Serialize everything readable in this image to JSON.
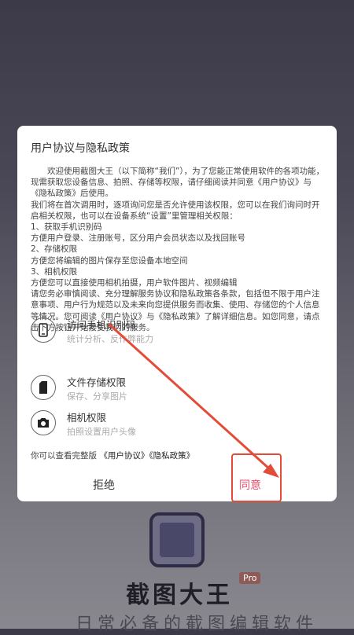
{
  "background": {
    "brand": "截图大王",
    "pro_badge": "Pro",
    "slogan": "日常必备的截图编辑软件"
  },
  "dialog": {
    "title": "用户协议与隐私政策",
    "paragraphs": [
      "　　欢迎使用截图大王（以下简称“我们”），为了您能正常使用软件的各项功能，现需获取您设备信息、拍照、存储等权限，请仔细阅读并同意《用户协议》与《隐私政策》后使用。",
      "我们将在首次调用时，逐项询问您是否允许使用该权限，您可以在我们询问时开启相关权限，也可以在设备系统“设置”里管理相关权限：",
      "1、获取手机识别码",
      "方便用户登录、注册账号，区分用户会员状态以及找回账号",
      "2、存储权限",
      "方便您将编辑的图片保存至您设备本地空间",
      "3、相机权限",
      "方便您可以直接使用相机拍摄，用户软件图片、视频编辑",
      "请您务必审慎阅读、充分理解服务协议和隐私政策各条款，包括但不限于用户注意事项、用户行为规范以及未来向您提供服务而收集、使用、存储您的个人信息等情况。您可阅读《用户协议》与《隐私政策》了解详细信息。如您同意，请点击下方按钮开始接受我们的服务。"
    ],
    "permissions": [
      {
        "icon": "phone-icon",
        "name": "访问手机识别码",
        "desc": "统计分析、反作弊能力"
      },
      {
        "icon": "sd-card-icon",
        "name": "文件存储权限",
        "desc": "保存、分享图片"
      },
      {
        "icon": "camera-icon",
        "name": "相机权限",
        "desc": "拍照设置用户头像"
      }
    ],
    "links_prefix": "你可以查看完整版",
    "link_user_agreement": "《用户协议》",
    "link_privacy": "《隐私政策》",
    "reject_label": "拒绝",
    "agree_label": "同意"
  },
  "colors": {
    "agree": "#ec4d6e",
    "annotation": "#e44c3a"
  }
}
